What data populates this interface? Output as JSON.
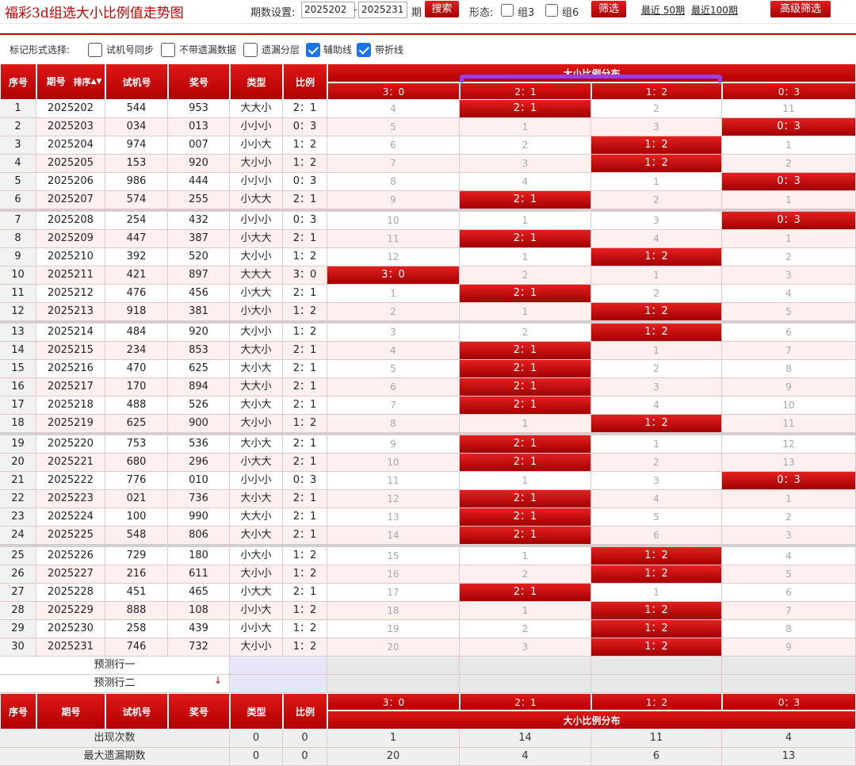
{
  "title": "福彩3d组选大小比例值走势图",
  "toolbar": {
    "period_label": "期数设置:",
    "from": "2025202",
    "dash": "-",
    "to": "2025231",
    "period_suffix": "期",
    "search_label": "搜索",
    "form_label": "形态:",
    "group3_label": "组3",
    "group6_label": "组6",
    "filter_label": "筛选",
    "recent50": "最近 50期",
    "recent100": "最近100期",
    "advanced_label": "高级筛选"
  },
  "options": {
    "label": "标记形式选择:",
    "items": [
      {
        "label": "试机号同步",
        "checked": false
      },
      {
        "label": "不带遗漏数据",
        "checked": false
      },
      {
        "label": "遗漏分层",
        "checked": false
      },
      {
        "label": "辅助线",
        "checked": true
      },
      {
        "label": "带折线",
        "checked": true
      }
    ]
  },
  "header": {
    "seq": "序号",
    "issue": "期号",
    "sort": "排序",
    "test": "试机号",
    "prize": "奖号",
    "type": "类型",
    "ratio": "比例",
    "group_title": "大小比例分布",
    "ratio_cols": [
      "3：0",
      "2：1",
      "1：2",
      "0：3"
    ]
  },
  "rows": [
    {
      "seq": "1",
      "issue": "2025202",
      "test": "544",
      "prize": "953",
      "type": "大大小",
      "ratio": "2：1",
      "dist": [
        "4",
        "2：1",
        "2",
        "11"
      ]
    },
    {
      "seq": "2",
      "issue": "2025203",
      "test": "034",
      "prize": "013",
      "type": "小小小",
      "ratio": "0：3",
      "dist": [
        "5",
        "1",
        "3",
        "0：3"
      ]
    },
    {
      "seq": "3",
      "issue": "2025204",
      "test": "974",
      "prize": "007",
      "type": "小小大",
      "ratio": "1：2",
      "dist": [
        "6",
        "2",
        "1：2",
        "1"
      ]
    },
    {
      "seq": "4",
      "issue": "2025205",
      "test": "153",
      "prize": "920",
      "type": "大小小",
      "ratio": "1：2",
      "dist": [
        "7",
        "3",
        "1：2",
        "2"
      ]
    },
    {
      "seq": "5",
      "issue": "2025206",
      "test": "986",
      "prize": "444",
      "type": "小小小",
      "ratio": "0：3",
      "dist": [
        "8",
        "4",
        "1",
        "0：3"
      ]
    },
    {
      "seq": "6",
      "issue": "2025207",
      "test": "574",
      "prize": "255",
      "type": "小大大",
      "ratio": "2：1",
      "dist": [
        "9",
        "2：1",
        "2",
        "1"
      ]
    },
    {
      "seq": "7",
      "issue": "2025208",
      "test": "254",
      "prize": "432",
      "type": "小小小",
      "ratio": "0：3",
      "dist": [
        "10",
        "1",
        "3",
        "0：3"
      ]
    },
    {
      "seq": "8",
      "issue": "2025209",
      "test": "447",
      "prize": "387",
      "type": "小大大",
      "ratio": "2：1",
      "dist": [
        "11",
        "2：1",
        "4",
        "1"
      ]
    },
    {
      "seq": "9",
      "issue": "2025210",
      "test": "392",
      "prize": "520",
      "type": "大小小",
      "ratio": "1：2",
      "dist": [
        "12",
        "1",
        "1：2",
        "2"
      ]
    },
    {
      "seq": "10",
      "issue": "2025211",
      "test": "421",
      "prize": "897",
      "type": "大大大",
      "ratio": "3：0",
      "dist": [
        "3：0",
        "2",
        "1",
        "3"
      ]
    },
    {
      "seq": "11",
      "issue": "2025212",
      "test": "476",
      "prize": "456",
      "type": "小大大",
      "ratio": "2：1",
      "dist": [
        "1",
        "2：1",
        "2",
        "4"
      ]
    },
    {
      "seq": "12",
      "issue": "2025213",
      "test": "918",
      "prize": "381",
      "type": "小大小",
      "ratio": "1：2",
      "dist": [
        "2",
        "1",
        "1：2",
        "5"
      ]
    },
    {
      "seq": "13",
      "issue": "2025214",
      "test": "484",
      "prize": "920",
      "type": "大小小",
      "ratio": "1：2",
      "dist": [
        "3",
        "2",
        "1：2",
        "6"
      ]
    },
    {
      "seq": "14",
      "issue": "2025215",
      "test": "234",
      "prize": "853",
      "type": "大大小",
      "ratio": "2：1",
      "dist": [
        "4",
        "2：1",
        "1",
        "7"
      ]
    },
    {
      "seq": "15",
      "issue": "2025216",
      "test": "470",
      "prize": "625",
      "type": "大小大",
      "ratio": "2：1",
      "dist": [
        "5",
        "2：1",
        "2",
        "8"
      ]
    },
    {
      "seq": "16",
      "issue": "2025217",
      "test": "170",
      "prize": "894",
      "type": "大大小",
      "ratio": "2：1",
      "dist": [
        "6",
        "2：1",
        "3",
        "9"
      ]
    },
    {
      "seq": "17",
      "issue": "2025218",
      "test": "488",
      "prize": "526",
      "type": "大小大",
      "ratio": "2：1",
      "dist": [
        "7",
        "2：1",
        "4",
        "10"
      ]
    },
    {
      "seq": "18",
      "issue": "2025219",
      "test": "625",
      "prize": "900",
      "type": "大小小",
      "ratio": "1：2",
      "dist": [
        "8",
        "1",
        "1：2",
        "11"
      ]
    },
    {
      "seq": "19",
      "issue": "2025220",
      "test": "753",
      "prize": "536",
      "type": "大小大",
      "ratio": "2：1",
      "dist": [
        "9",
        "2：1",
        "1",
        "12"
      ]
    },
    {
      "seq": "20",
      "issue": "2025221",
      "test": "680",
      "prize": "296",
      "type": "小大大",
      "ratio": "2：1",
      "dist": [
        "10",
        "2：1",
        "2",
        "13"
      ]
    },
    {
      "seq": "21",
      "issue": "2025222",
      "test": "776",
      "prize": "010",
      "type": "小小小",
      "ratio": "0：3",
      "dist": [
        "11",
        "1",
        "3",
        "0：3"
      ]
    },
    {
      "seq": "22",
      "issue": "2025223",
      "test": "021",
      "prize": "736",
      "type": "大小大",
      "ratio": "2：1",
      "dist": [
        "12",
        "2：1",
        "4",
        "1"
      ]
    },
    {
      "seq": "23",
      "issue": "2025224",
      "test": "100",
      "prize": "990",
      "type": "大大小",
      "ratio": "2：1",
      "dist": [
        "13",
        "2：1",
        "5",
        "2"
      ]
    },
    {
      "seq": "24",
      "issue": "2025225",
      "test": "548",
      "prize": "806",
      "type": "大小大",
      "ratio": "2：1",
      "dist": [
        "14",
        "2：1",
        "6",
        "3"
      ]
    },
    {
      "seq": "25",
      "issue": "2025226",
      "test": "729",
      "prize": "180",
      "type": "小大小",
      "ratio": "1：2",
      "dist": [
        "15",
        "1",
        "1：2",
        "4"
      ]
    },
    {
      "seq": "26",
      "issue": "2025227",
      "test": "216",
      "prize": "611",
      "type": "大小小",
      "ratio": "1：2",
      "dist": [
        "16",
        "2",
        "1：2",
        "5"
      ]
    },
    {
      "seq": "27",
      "issue": "2025228",
      "test": "451",
      "prize": "465",
      "type": "小大大",
      "ratio": "2：1",
      "dist": [
        "17",
        "2：1",
        "1",
        "6"
      ]
    },
    {
      "seq": "28",
      "issue": "2025229",
      "test": "888",
      "prize": "108",
      "type": "小小大",
      "ratio": "1：2",
      "dist": [
        "18",
        "1",
        "1：2",
        "7"
      ]
    },
    {
      "seq": "29",
      "issue": "2025230",
      "test": "258",
      "prize": "439",
      "type": "小小大",
      "ratio": "1：2",
      "dist": [
        "19",
        "2",
        "1：2",
        "8"
      ]
    },
    {
      "seq": "30",
      "issue": "2025231",
      "test": "746",
      "prize": "732",
      "type": "大小小",
      "ratio": "1：2",
      "dist": [
        "20",
        "3",
        "1：2",
        "9"
      ]
    }
  ],
  "predict": [
    "预测行一",
    "预测行二"
  ],
  "footer": {
    "appear_label": "出现次数",
    "appear": [
      "0",
      "0",
      "1",
      "14",
      "11",
      "4"
    ],
    "maxmiss_label": "最大遗漏期数",
    "maxmiss": [
      "0",
      "0",
      "20",
      "4",
      "6",
      "13"
    ]
  },
  "colors": {
    "red": "#c00000",
    "highlight": "#9b3ef0",
    "line": "#999999"
  }
}
